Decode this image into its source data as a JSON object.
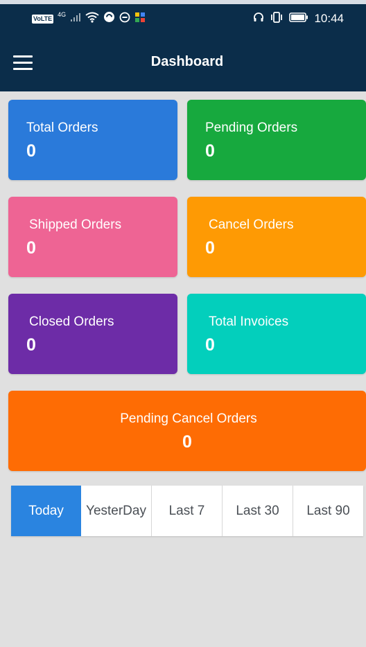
{
  "status_bar": {
    "volte": "VoLTE",
    "network": "4G",
    "time": "10:44",
    "icons_left": [
      "volte-icon",
      "signal-icon",
      "wifi-icon",
      "sync-icon",
      "minus-circle-icon",
      "app-icon"
    ],
    "icons_right": [
      "headset-icon",
      "vibrate-icon",
      "battery-icon"
    ]
  },
  "toolbar": {
    "title": "Dashboard",
    "menu_icon": "hamburger-menu-icon",
    "background": "#0b2d4a"
  },
  "cards": {
    "total_orders": {
      "label": "Total Orders",
      "count": "0",
      "color": "#2a7ada"
    },
    "pending_orders": {
      "label": "Pending Orders",
      "count": "0",
      "color": "#17a93e"
    },
    "shipped_orders": {
      "label": "Shipped Orders",
      "count": "0",
      "color": "#ee6494"
    },
    "cancel_orders": {
      "label": "Cancel Orders",
      "count": "0",
      "color": "#fe9a04"
    },
    "closed_orders": {
      "label": "Closed Orders",
      "count": "0",
      "color": "#6d2ca7"
    },
    "total_invoices": {
      "label": "Total Invoices",
      "count": "0",
      "color": "#03cfbc"
    },
    "pending_cancel_orders": {
      "label": "Pending Cancel Orders",
      "count": "0",
      "color": "#fe6c04"
    }
  },
  "filters": {
    "selected": "Today",
    "active_color": "#2a84e0",
    "tabs": [
      "Today",
      "YesterDay",
      "Last 7",
      "Last 30",
      "Last 90"
    ]
  }
}
